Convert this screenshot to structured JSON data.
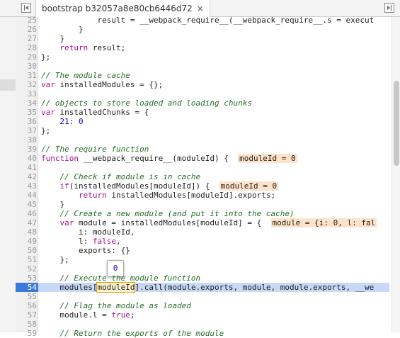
{
  "tab": {
    "title": "bootstrap b32057a8e80cb6446d72",
    "close": "×"
  },
  "tooltip": "0",
  "lines": [
    {
      "n": "25",
      "html": "            result = __webpack_require__(__webpack_require__.s = execut"
    },
    {
      "n": "26",
      "html": "        }"
    },
    {
      "n": "27",
      "html": "    }"
    },
    {
      "n": "28",
      "html": "    <span class=\"kw\">return</span> result;"
    },
    {
      "n": "29",
      "html": "};"
    },
    {
      "n": "30",
      "html": ""
    },
    {
      "n": "31",
      "html": "<span class=\"cm\">// The module cache</span>"
    },
    {
      "n": "32",
      "html": "<span class=\"kw\">var</span> installedModules = {};"
    },
    {
      "n": "33",
      "html": ""
    },
    {
      "n": "34",
      "html": "<span class=\"cm\">// objects to store loaded and loading chunks</span>"
    },
    {
      "n": "35",
      "html": "<span class=\"kw\">var</span> installedChunks = {"
    },
    {
      "n": "36",
      "html": "    <span class=\"num\">21</span>: <span class=\"num\">0</span>"
    },
    {
      "n": "37",
      "html": "};"
    },
    {
      "n": "38",
      "html": ""
    },
    {
      "n": "39",
      "html": "<span class=\"cm\">// The require function</span>"
    },
    {
      "n": "40",
      "html": "<span class=\"kw\">function</span> __webpack_require__(moduleId) {  <span class=\"inl\">moduleId = 0</span>"
    },
    {
      "n": "41",
      "html": ""
    },
    {
      "n": "42",
      "html": "    <span class=\"cm\">// Check if module is in cache</span>"
    },
    {
      "n": "43",
      "html": "    <span class=\"kw\">if</span>(installedModules[moduleId]) {  <span class=\"inl\">moduleId = 0</span>"
    },
    {
      "n": "44",
      "html": "        <span class=\"kw\">return</span> installedModules[moduleId].exports;"
    },
    {
      "n": "45",
      "html": "    }"
    },
    {
      "n": "46",
      "html": "    <span class=\"cm\">// Create a new module (and put it into the cache)</span>"
    },
    {
      "n": "47",
      "html": "    <span class=\"kw\">var</span> module = installedModules[moduleId] = {  <span class=\"inl\">module = {i: 0, l: fal</span>"
    },
    {
      "n": "48",
      "html": "        i: moduleId,"
    },
    {
      "n": "49",
      "html": "        l: <span class=\"kw\">false</span>,"
    },
    {
      "n": "50",
      "html": "        exports: {}"
    },
    {
      "n": "51",
      "html": "    };"
    },
    {
      "n": "52",
      "html": ""
    },
    {
      "n": "53",
      "html": "    <span class=\"cm\">// Execute the module function</span>"
    },
    {
      "n": "54",
      "html": "    modules[<span class=\"box\">moduleId</span>].call(module.exports, module, module.exports, __we",
      "active": true
    },
    {
      "n": "55",
      "html": ""
    },
    {
      "n": "56",
      "html": "    <span class=\"cm\">// Flag the module as loaded</span>"
    },
    {
      "n": "57",
      "html": "    module.l = <span class=\"kw\">true</span>;"
    },
    {
      "n": "58",
      "html": ""
    },
    {
      "n": "59",
      "html": "    <span class=\"cm\">// Return the exports of the module</span>"
    }
  ]
}
